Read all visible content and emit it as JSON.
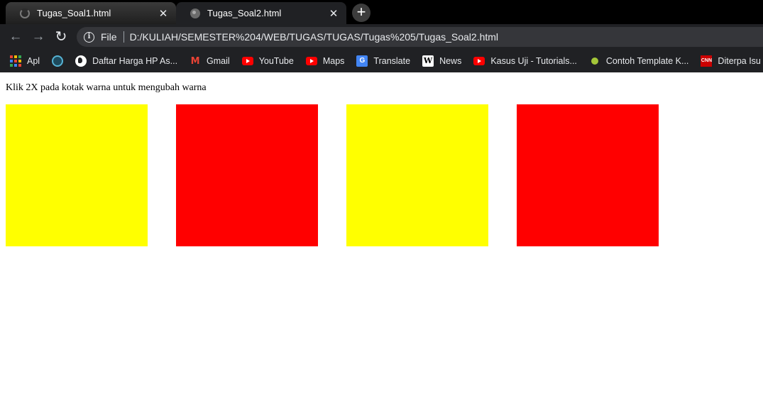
{
  "tabs": [
    {
      "title": "Tugas_Soal1.html",
      "active": false
    },
    {
      "title": "Tugas_Soal2.html",
      "active": true
    }
  ],
  "toolbar": {
    "scheme_label": "File",
    "url": "D:/KULIAH/SEMESTER%204/WEB/TUGAS/TUGAS/Tugas%205/Tugas_Soal2.html"
  },
  "bookmarks": [
    {
      "label": "Apl",
      "icon": "apps-grid-icon"
    },
    {
      "label": "",
      "icon": "circle-logo-icon"
    },
    {
      "label": "Daftar Harga HP As...",
      "icon": "globe-icon"
    },
    {
      "label": "Gmail",
      "icon": "gmail-icon"
    },
    {
      "label": "YouTube",
      "icon": "youtube-icon"
    },
    {
      "label": "Maps",
      "icon": "youtube-icon"
    },
    {
      "label": "Translate",
      "icon": "translate-icon"
    },
    {
      "label": "News",
      "icon": "wikipedia-icon"
    },
    {
      "label": "Kasus Uji - Tutorials...",
      "icon": "youtube-icon"
    },
    {
      "label": "Contoh Template K...",
      "icon": "green-dot-icon"
    },
    {
      "label": "Diterpa Isu Tak Sed",
      "icon": "cnn-icon"
    }
  ],
  "page": {
    "instruction": "Klik 2X pada kotak warna untuk mengubah warna",
    "boxes": [
      {
        "color": "#ffff00"
      },
      {
        "color": "#ff0000"
      },
      {
        "color": "#ffff00"
      },
      {
        "color": "#ff0000"
      }
    ]
  },
  "colors": {
    "chrome_dark": "#202124",
    "tabstrip": "#000000",
    "omnibox": "#35363a",
    "yellow": "#ffff00",
    "red": "#ff0000"
  }
}
